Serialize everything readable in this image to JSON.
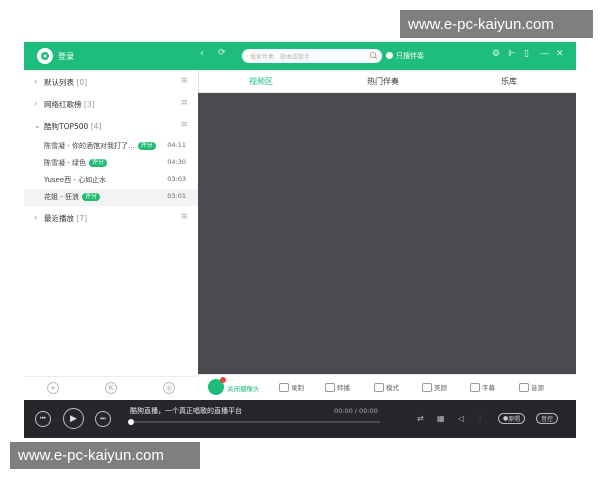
{
  "watermarks": {
    "top": "www.e-pc-kaiyun.com",
    "bottom": "www.e-pc-kaiyun.com"
  },
  "header": {
    "login_label": "登录",
    "search_placeholder": "搜索伴奏、歌曲或歌手",
    "only_accompaniment_label": "只搜伴奏",
    "icons": [
      "back-icon",
      "forward-icon",
      "refresh-icon",
      "search-icon",
      "settings-icon",
      "skin-icon",
      "mini-mode-icon",
      "minimize-icon",
      "close-icon"
    ]
  },
  "sidebar": {
    "groups": [
      {
        "name": "默认列表",
        "count": "[0]",
        "expanded": false
      },
      {
        "name": "网络红歌榜",
        "count": "[3]",
        "expanded": false
      },
      {
        "name": "酷狗TOP500",
        "count": "[4]",
        "expanded": true
      },
      {
        "name": "最近播放",
        "count": "[7]",
        "expanded": false
      }
    ],
    "songs": [
      {
        "title": "陈雪凝 - 你的酒馆对我打了...",
        "tag": "评分",
        "duration": "04:11"
      },
      {
        "title": "陈雪凝 - 绿色",
        "tag": "评分",
        "duration": "04:30"
      },
      {
        "title": "Yusee西 - 心如止水",
        "tag": "",
        "duration": "03:03"
      },
      {
        "title": "花姐 - 狂浪",
        "tag": "评分",
        "duration": "03:01"
      }
    ],
    "footer_icons": [
      "add-icon",
      "import-icon",
      "locate-icon"
    ]
  },
  "tabs": [
    {
      "label": "视频区",
      "active": true
    },
    {
      "label": "热门伴奏",
      "active": false
    },
    {
      "label": "乐库",
      "active": false
    }
  ],
  "video_toolbar": {
    "camera_label": "关闭摄像头",
    "items": [
      "录制",
      "转播",
      "模式",
      "美颜",
      "字幕",
      "音源"
    ]
  },
  "player": {
    "title": "酷狗直播，一个真正唱歌的直播平台",
    "time": "00:00 / 00:00",
    "progress": 0,
    "original_label": "原唱",
    "score_label": "音控"
  },
  "colors": {
    "accent": "#1fbd7d",
    "video_bg": "#4b4a4f",
    "player_bg": "#26272b",
    "tag": "#22bb6f"
  }
}
